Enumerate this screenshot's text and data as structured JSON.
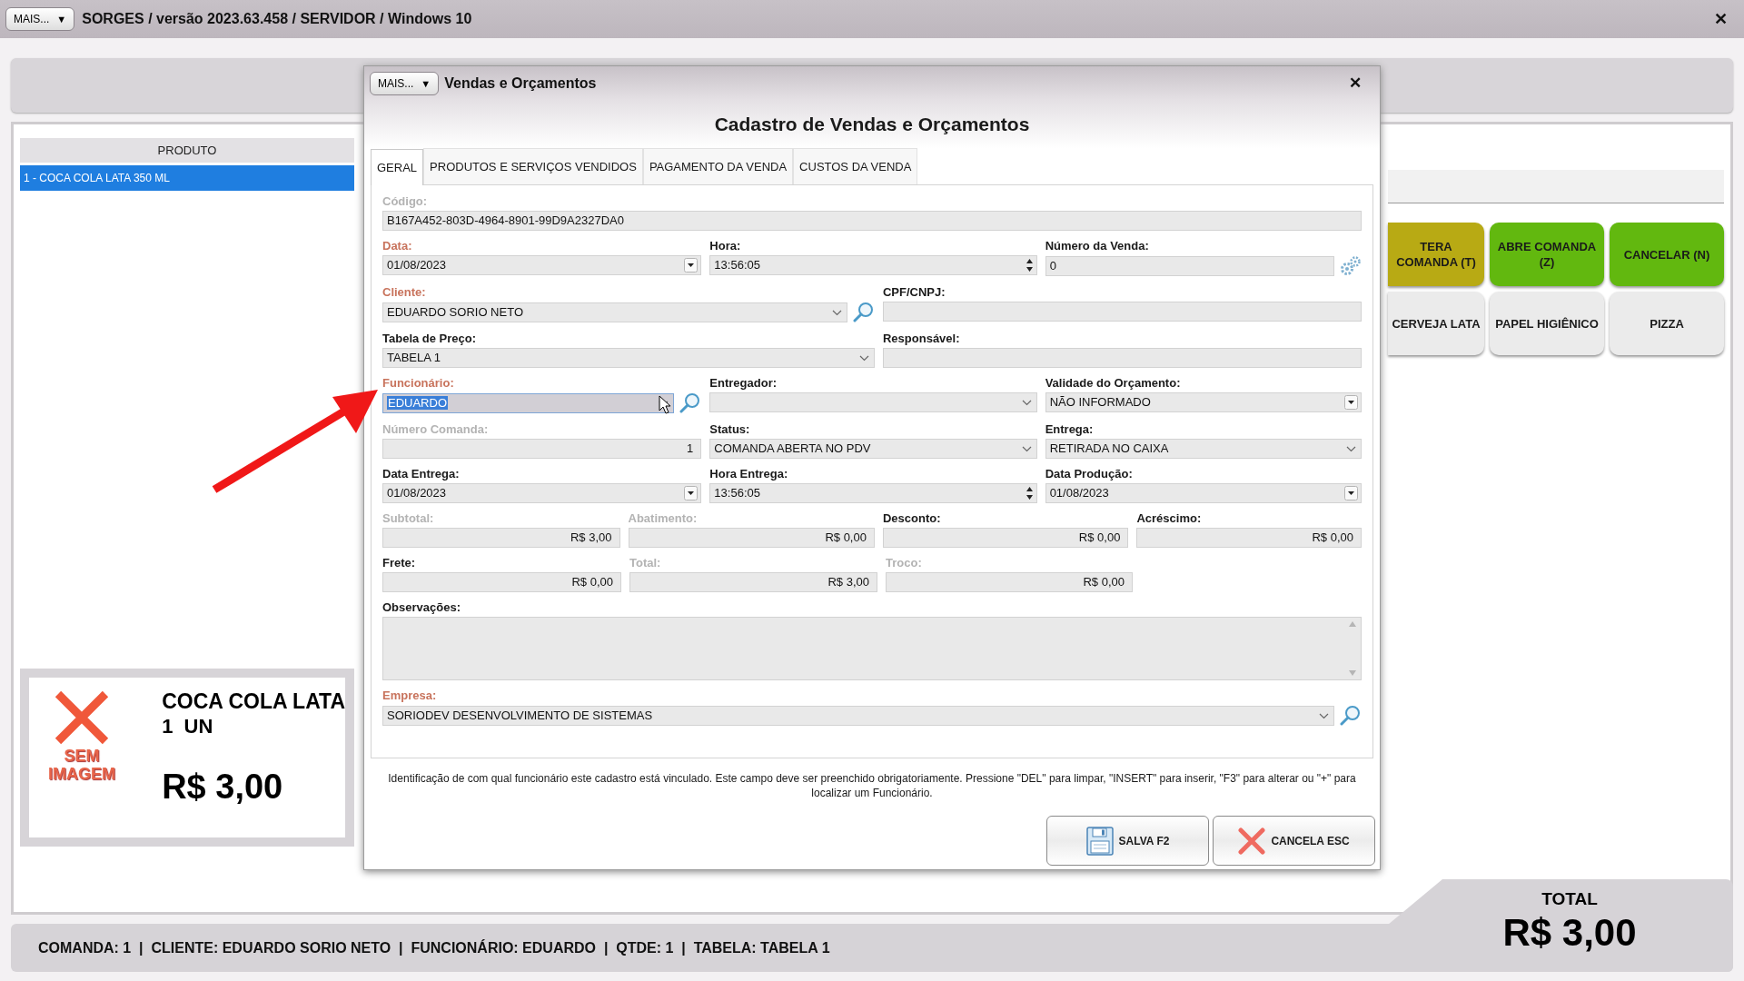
{
  "app": {
    "menu_button": {
      "label": "MAIS...",
      "caret": "▼"
    },
    "title": "SORGES / versão 2023.63.458 / SERVIDOR / Windows 10",
    "close": "✕"
  },
  "products": {
    "column": "PRODUTO",
    "rows": [
      {
        "label": "1 - COCA COLA LATA 350 ML",
        "selected": true
      }
    ]
  },
  "product_card": {
    "image_label": [
      "SEM",
      "IMAGEM"
    ],
    "name": "COCA COLA LATA",
    "quantity": "1  UN",
    "price": "R$ 3,00"
  },
  "shortcuts": [
    {
      "label": "TERA COMANDA (T)",
      "color": "#b8aa14"
    },
    {
      "label": "ABRE COMANDA (Z)",
      "color": "#62b80f"
    },
    {
      "label": "CANCELAR (N)",
      "color": "#62b80f"
    },
    {
      "label": "CERVEJA LATA",
      "color": "#ebebeb"
    },
    {
      "label": "PAPEL HIGIÊNICO",
      "color": "#ebebeb"
    },
    {
      "label": "PIZZA",
      "color": "#ebebeb"
    }
  ],
  "status_bar": {
    "text": "COMANDA: 1  |  CLIENTE: EDUARDO SORIO NETO  |  FUNCIONÁRIO: EDUARDO  |  QTDE: 1  |  TABELA: TABELA 1"
  },
  "total": {
    "label": "TOTAL",
    "value": "R$ 3,00"
  },
  "dialog": {
    "menu_button": {
      "label": "MAIS...",
      "caret": "▼"
    },
    "title": "Vendas e Orçamentos",
    "close": "✕",
    "heading": "Cadastro de Vendas e Orçamentos",
    "tabs": [
      {
        "label": "GERAL",
        "selected": true
      },
      {
        "label": "PRODUTOS E SERVIÇOS VENDIDOS",
        "selected": false
      },
      {
        "label": "PAGAMENTO DA VENDA",
        "selected": false
      },
      {
        "label": "CUSTOS DA VENDA",
        "selected": false
      }
    ],
    "rows": [
      {
        "fields": [
          {
            "label": "Código:",
            "required": false,
            "disabled": true,
            "kind": "text",
            "value": "B167A452-803D-4964-8901-99D9A2327DA0",
            "focused": false,
            "lookup": false,
            "settings": false
          }
        ]
      },
      {
        "fields": [
          {
            "label": "Data:",
            "required": true,
            "disabled": false,
            "kind": "picker",
            "value": "01/08/2023",
            "focused": false,
            "lookup": false,
            "settings": false
          },
          {
            "label": "Hora:",
            "required": false,
            "disabled": false,
            "kind": "spin",
            "value": "13:56:05",
            "focused": false,
            "lookup": false,
            "settings": false
          },
          {
            "label": "Número da Venda:",
            "required": false,
            "disabled": false,
            "kind": "text",
            "value": "0",
            "focused": false,
            "lookup": false,
            "settings": true
          }
        ]
      },
      {
        "fields": [
          {
            "label": "Cliente:",
            "required": true,
            "disabled": false,
            "kind": "combo",
            "value": "EDUARDO SORIO NETO",
            "focused": false,
            "lookup": true,
            "settings": false
          },
          {
            "label": "CPF/CNPJ:",
            "required": false,
            "disabled": false,
            "kind": "text",
            "focused": false,
            "lookup": false,
            "settings": false
          }
        ]
      },
      {
        "fields": [
          {
            "label": "Tabela de Preço:",
            "required": false,
            "disabled": false,
            "kind": "combo",
            "value": "TABELA 1",
            "focused": false,
            "lookup": false,
            "settings": false
          },
          {
            "label": "Responsável:",
            "required": false,
            "disabled": false,
            "kind": "text",
            "focused": false,
            "lookup": false,
            "settings": false
          }
        ]
      },
      {
        "fields": [
          {
            "label": "Funcionário:",
            "required": true,
            "disabled": false,
            "kind": "combo",
            "value": "EDUARDO",
            "focused": true,
            "lookup": true,
            "settings": false
          },
          {
            "label": "Entregador:",
            "required": false,
            "disabled": false,
            "kind": "combo",
            "focused": false,
            "lookup": false,
            "settings": false
          },
          {
            "label": "Validade do Orçamento:",
            "required": false,
            "disabled": false,
            "kind": "picker",
            "value": "NÃO INFORMADO",
            "focused": false,
            "lookup": false,
            "settings": false
          }
        ]
      },
      {
        "fields": [
          {
            "label": "Número Comanda:",
            "required": false,
            "disabled": true,
            "kind": "number",
            "value": "1",
            "focused": false,
            "lookup": false,
            "settings": false
          },
          {
            "label": "Status:",
            "required": false,
            "disabled": false,
            "kind": "combo",
            "value": "COMANDA ABERTA NO PDV",
            "focused": false,
            "lookup": false,
            "settings": false
          },
          {
            "label": "Entrega:",
            "required": false,
            "disabled": false,
            "kind": "combo",
            "value": "RETIRADA NO CAIXA",
            "focused": false,
            "lookup": false,
            "settings": false
          }
        ]
      },
      {
        "fields": [
          {
            "label": "Data Entrega:",
            "required": false,
            "disabled": false,
            "kind": "picker",
            "value": "01/08/2023",
            "focused": false,
            "lookup": false,
            "settings": false
          },
          {
            "label": "Hora Entrega:",
            "required": false,
            "disabled": false,
            "kind": "spin",
            "value": "13:56:05",
            "focused": false,
            "lookup": false,
            "settings": false
          },
          {
            "label": "Data Produção:",
            "required": false,
            "disabled": false,
            "kind": "picker",
            "value": "01/08/2023",
            "focused": false,
            "lookup": false,
            "settings": false
          }
        ]
      },
      {
        "fields": [
          {
            "label": "Subtotal:",
            "required": false,
            "disabled": true,
            "kind": "number",
            "value": "R$ 3,00",
            "focused": false,
            "lookup": false,
            "settings": false
          },
          {
            "label": "Abatimento:",
            "required": false,
            "disabled": true,
            "kind": "number",
            "value": "R$ 0,00",
            "focused": false,
            "lookup": false,
            "settings": false
          },
          {
            "label": "Desconto:",
            "required": false,
            "disabled": false,
            "kind": "number",
            "value": "R$ 0,00",
            "focused": false,
            "lookup": false,
            "settings": false
          },
          {
            "label": "Acréscimo:",
            "required": false,
            "disabled": false,
            "kind": "number",
            "value": "R$ 0,00",
            "focused": false,
            "lookup": false,
            "settings": false
          }
        ]
      },
      {
        "fields": [
          {
            "label": "Frete:",
            "required": false,
            "disabled": false,
            "kind": "number",
            "value": "R$ 0,00",
            "focused": false,
            "lookup": false,
            "settings": false
          },
          {
            "label": "Total:",
            "required": false,
            "disabled": true,
            "kind": "number",
            "value": "R$ 3,00",
            "focused": false,
            "lookup": false,
            "settings": false
          },
          {
            "label": "Troco:",
            "required": false,
            "disabled": true,
            "kind": "number",
            "value": "R$ 0,00",
            "focused": false,
            "lookup": false,
            "settings": false
          }
        ]
      },
      {
        "fields": [
          {
            "label": "Observações:",
            "required": false,
            "disabled": false,
            "kind": "memo",
            "focused": false,
            "lookup": false,
            "settings": false
          }
        ]
      },
      {
        "fields": [
          {
            "label": "Empresa:",
            "required": true,
            "disabled": false,
            "kind": "combo",
            "value": "SORIODEV DESENVOLVIMENTO DE SISTEMAS",
            "focused": false,
            "lookup": true,
            "settings": false
          }
        ]
      }
    ],
    "help": "Identificação de com qual funcionário este cadastro está vinculado. Este campo deve ser preenchido obrigatoriamente. Pressione \"DEL\" para limpar, \"INSERT\" para inserir, \"F3\" para alterar ou \"+\" para localizar um Funcionário.",
    "buttons": [
      {
        "label": "SALVA F2",
        "kind": "save"
      },
      {
        "label": "CANCELA ESC",
        "kind": "cancel"
      }
    ]
  }
}
